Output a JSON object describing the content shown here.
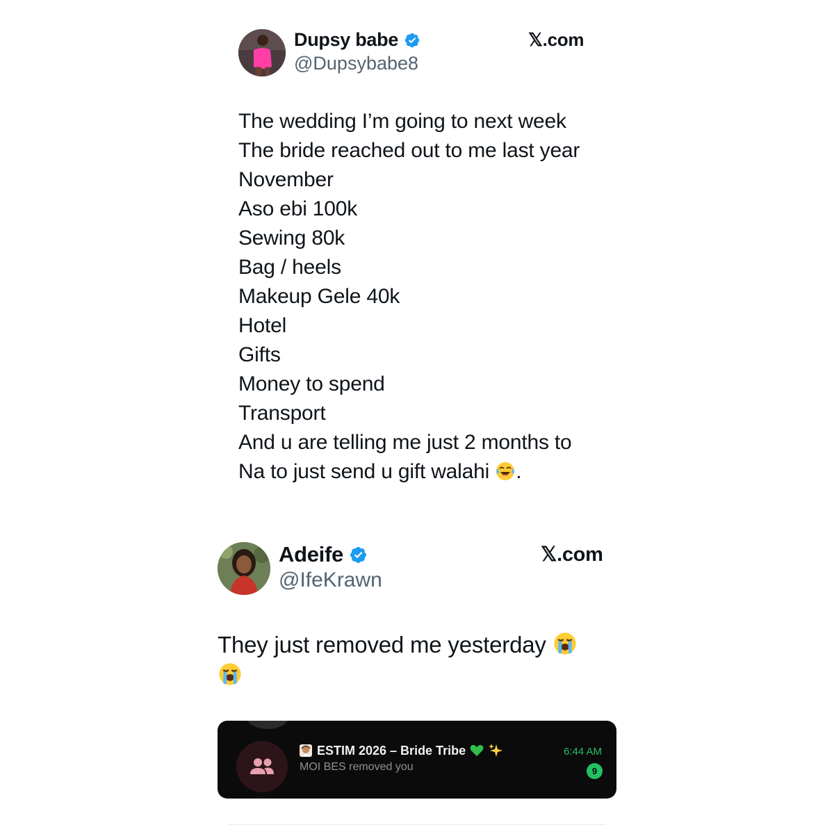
{
  "tweet1": {
    "display_name": "Dupsy babe",
    "handle": "@Dupsybabe8",
    "site": "𝕏.com",
    "lines": [
      "The wedding I’m going to next week",
      "The bride reached out to me last year",
      "November",
      "Aso ebi 100k",
      "Sewing 80k",
      "Bag / heels",
      "Makeup Gele 40k",
      "Hotel",
      "Gifts",
      "Money to spend",
      "Transport",
      "And u are telling me just 2 months to",
      "Na to just send u gift walahi"
    ],
    "last_line_suffix": ".",
    "emoji": "face-with-tears-of-joy"
  },
  "tweet2": {
    "display_name": "Adeife",
    "handle": "@IfeKrawn",
    "site": "𝕏.com",
    "text": "They just removed me yesterday",
    "emoji": "loudly-crying-face"
  },
  "whatsapp_notification": {
    "group_name": "ESTIM 2026 – Bride Tribe",
    "message": "MOI BES removed you",
    "time": "6:44 AM",
    "unread_count": "9",
    "accent_color": "#21c063"
  },
  "colors": {
    "verified_blue": "#1d9bf0",
    "handle_gray": "#536471"
  }
}
